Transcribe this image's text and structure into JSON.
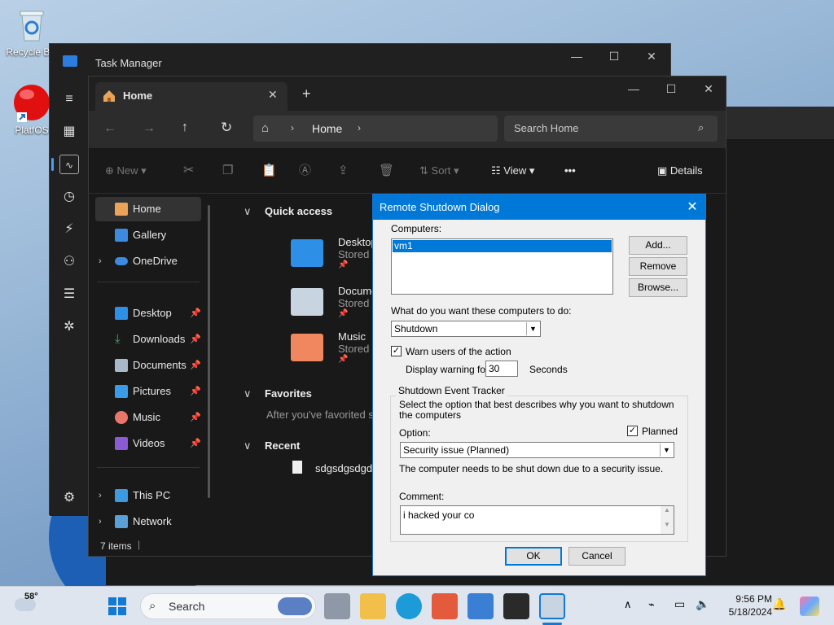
{
  "desktop": {
    "icons": [
      {
        "label": "Recycle Bin"
      },
      {
        "label": "PlatfOS"
      }
    ]
  },
  "task_manager": {
    "title": "Task Manager"
  },
  "explorer": {
    "tab_label": "Home",
    "address_crumb": "Home",
    "search_placeholder": "Search Home",
    "toolbar": {
      "new": "New",
      "sort": "Sort",
      "view": "View",
      "more": "•••",
      "details": "Details"
    },
    "nav": {
      "home": "Home",
      "gallery": "Gallery",
      "onedrive": "OneDrive",
      "desktop": "Desktop",
      "downloads": "Downloads",
      "documents": "Documents",
      "pictures": "Pictures",
      "music": "Music",
      "videos": "Videos",
      "this_pc": "This PC",
      "network": "Network"
    },
    "main": {
      "quick_access": "Quick access",
      "qa_items": [
        {
          "name": "Desktop",
          "sub": "Stored lo"
        },
        {
          "name": "Docume",
          "sub": "Stored lo"
        },
        {
          "name": "Music",
          "sub": "Stored lo"
        }
      ],
      "favorites": "Favorites",
      "favorites_empty": "After you've favorited so",
      "recent": "Recent",
      "recent_file": "sdgsdgsdgds"
    },
    "status": "7 items"
  },
  "dialog": {
    "title": "Remote Shutdown Dialog",
    "computers_label": "Computers:",
    "computers": [
      "vm1"
    ],
    "add_button": "Add...",
    "remove_button": "Remove",
    "browse_button": "Browse...",
    "action_label": "What do you want these computers to do:",
    "action_value": "Shutdown",
    "warn_label": "Warn users of the action",
    "warn_checked": true,
    "display_warning_label": "Display warning for",
    "display_warning_value": "30",
    "seconds_label": "Seconds",
    "tracker_title": "Shutdown Event Tracker",
    "tracker_desc": "Select the option that best describes why you want to shutdown the computers",
    "option_label": "Option:",
    "planned_label": "Planned",
    "planned_checked": true,
    "option_value": "Security issue (Planned)",
    "option_desc": "The computer needs to be shut down due to a security issue.",
    "comment_label": "Comment:",
    "comment_value": "i hacked your co",
    "ok_button": "OK",
    "cancel_button": "Cancel"
  },
  "taskbar": {
    "weather_temp": "58°",
    "search_label": "Search",
    "time": "9:56 PM",
    "date": "5/18/2024"
  }
}
